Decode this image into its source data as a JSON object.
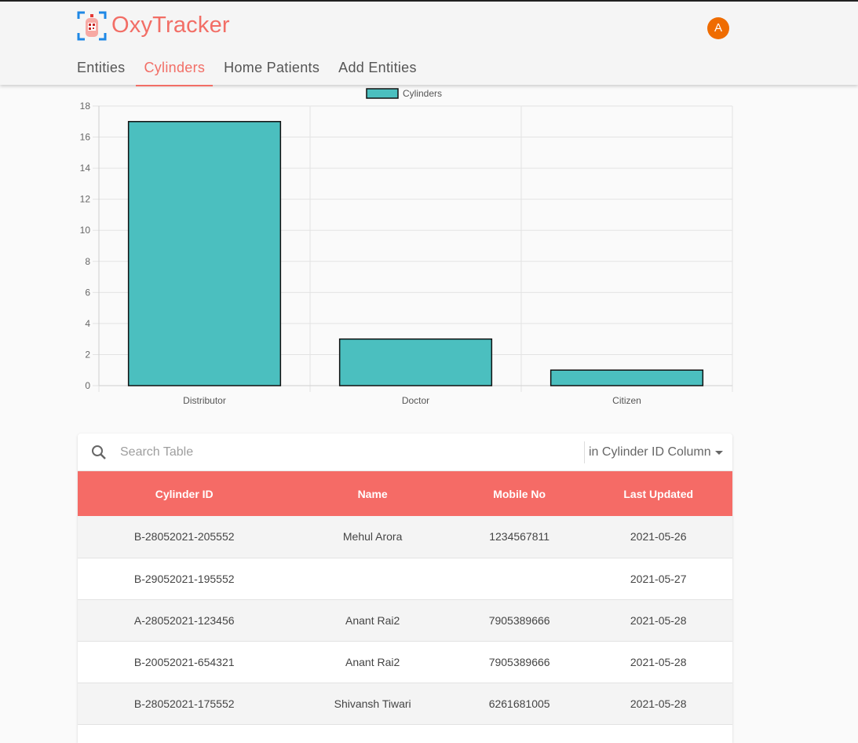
{
  "app": {
    "brand": "OxyTracker",
    "avatar_initial": "A"
  },
  "colors": {
    "accent": "#f26e66",
    "header_row": "#f56b66",
    "bar_fill": "#4bbfbf",
    "avatar": "#ef6c00"
  },
  "tabs": [
    {
      "label": "Entities",
      "active": false
    },
    {
      "label": "Cylinders",
      "active": true
    },
    {
      "label": "Home Patients",
      "active": false
    },
    {
      "label": "Add Entities",
      "active": false
    }
  ],
  "chart_data": {
    "type": "bar",
    "categories": [
      "Distributor",
      "Doctor",
      "Citizen"
    ],
    "series": [
      {
        "name": "Cylinders",
        "values": [
          17,
          3,
          1
        ]
      }
    ],
    "ylim": [
      0,
      18
    ],
    "yticks": [
      0,
      2,
      4,
      6,
      8,
      10,
      12,
      14,
      16,
      18
    ],
    "legend": "top-center",
    "grid": true
  },
  "search": {
    "placeholder": "Search Table",
    "column_select": "in Cylinder ID Column"
  },
  "table": {
    "columns": [
      "Cylinder ID",
      "Name",
      "Mobile No",
      "Last Updated"
    ],
    "rows": [
      [
        "B-28052021-205552",
        "Mehul Arora",
        "1234567811",
        "2021-05-26"
      ],
      [
        "B-29052021-195552",
        "",
        "",
        "2021-05-27"
      ],
      [
        "A-28052021-123456",
        "Anant Rai2",
        "7905389666",
        "2021-05-28"
      ],
      [
        "B-20052021-654321",
        "Anant Rai2",
        "7905389666",
        "2021-05-28"
      ],
      [
        "B-28052021-175552",
        "Shivansh Tiwari",
        "6261681005",
        "2021-05-28"
      ]
    ]
  }
}
